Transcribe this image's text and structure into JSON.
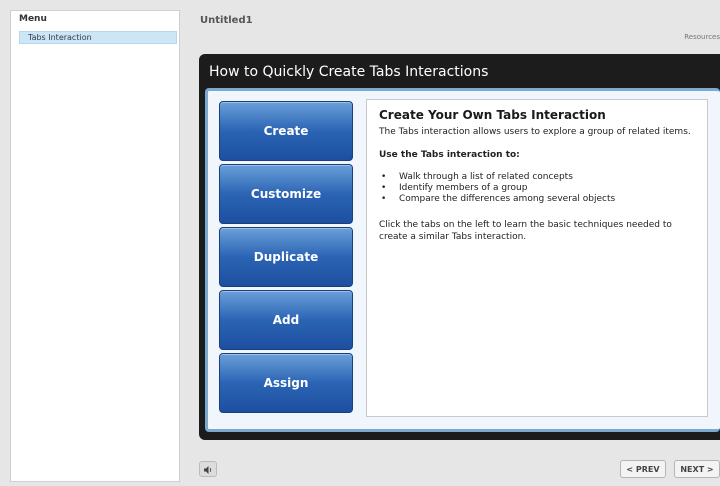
{
  "sidebar": {
    "header": "Menu",
    "items": [
      {
        "label": "Tabs Interaction"
      }
    ]
  },
  "player": {
    "title": "Untitled1",
    "resources_label": "Resources"
  },
  "slide": {
    "title": "How to Quickly Create Tabs Interactions",
    "tabs": [
      {
        "label": "Create"
      },
      {
        "label": "Customize"
      },
      {
        "label": "Duplicate"
      },
      {
        "label": "Add"
      },
      {
        "label": "Assign"
      }
    ],
    "content": {
      "heading": "Create Your Own Tabs Interaction",
      "intro": "The Tabs interaction allows users to explore a group of related items.",
      "subheading": "Use the Tabs interaction to:",
      "bullets": [
        "Walk through a list of related concepts",
        "Identify members of a group",
        "Compare the differences among several objects"
      ],
      "footer": "Click the tabs on the left to learn the basic techniques needed to create a similar Tabs interaction."
    }
  },
  "controls": {
    "audio_icon": "speaker-icon",
    "prev_label": "< PREV",
    "next_label": "NEXT >"
  },
  "colors": {
    "tab_blue": "#2b64b4",
    "slide_header": "#1c1c1c",
    "selected_menu": "#cde6f5"
  }
}
